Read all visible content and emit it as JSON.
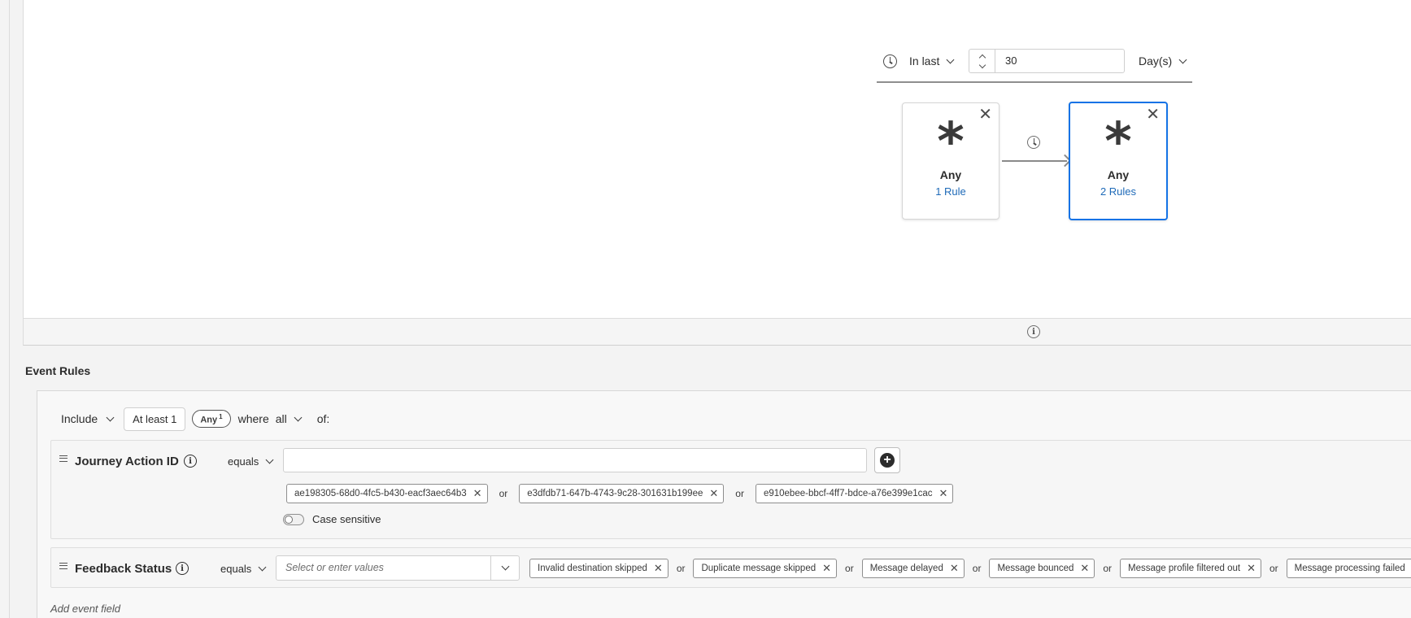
{
  "time_constraint": {
    "mode_label": "In last",
    "value": "30",
    "unit_label": "Day(s)"
  },
  "sequence": [
    {
      "symbol": "*",
      "name": "Any",
      "rules_label": "1 Rule",
      "selected": false
    },
    {
      "symbol": "*",
      "name": "Any",
      "rules_label": "2 Rules",
      "selected": true
    }
  ],
  "event_rules": {
    "title": "Event Rules",
    "include_label": "Include",
    "at_least_label": "At least 1",
    "any_badge_label": "Any",
    "any_badge_count": "1",
    "where_label": "where",
    "all_label": "all",
    "of_label": "of:",
    "fields": [
      {
        "label": "Journey Action ID",
        "operator": "equals",
        "input_value": "",
        "values": [
          "ae198305-68d0-4fc5-b430-eacf3aec64b3",
          "e3dfdb71-647b-4743-9c28-301631b199ee",
          "e910ebee-bbcf-4ff7-bdce-a76e399e1cac"
        ],
        "case_sensitive_label": "Case sensitive",
        "case_sensitive": false
      },
      {
        "label": "Feedback Status",
        "operator": "equals",
        "placeholder": "Select or enter values",
        "values": [
          "Invalid destination skipped",
          "Duplicate message skipped",
          "Message delayed",
          "Message bounced",
          "Message profile filtered out",
          "Message processing failed"
        ]
      }
    ],
    "or_label": "or",
    "add_event_field_label": "Add event field"
  }
}
